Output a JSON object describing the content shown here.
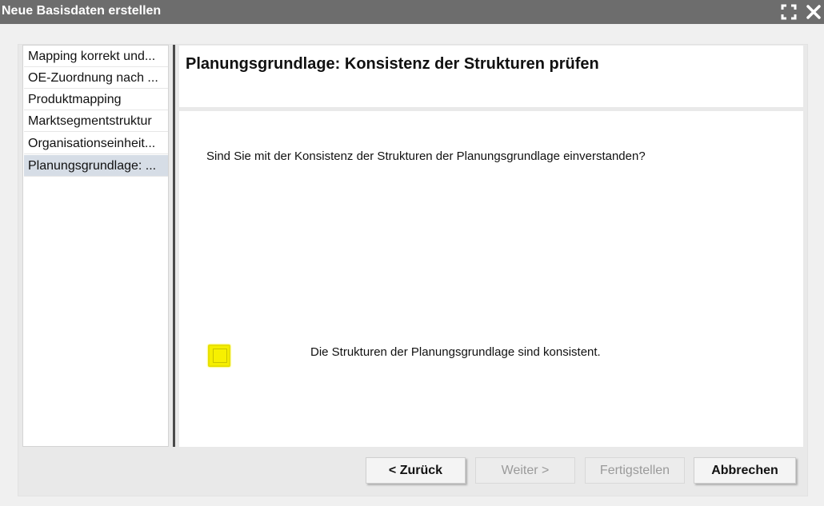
{
  "window": {
    "title": "Neue Basisdaten erstellen",
    "maximize_icon": "maximize-icon",
    "close_icon": "close-icon"
  },
  "sidebar": {
    "items": [
      {
        "label": "Mapping korrekt und..."
      },
      {
        "label": "OE-Zuordnung nach ..."
      },
      {
        "label": "Produktmapping"
      },
      {
        "label": "Marktsegmentstruktur"
      },
      {
        "label": "Organisationseinheit..."
      },
      {
        "label": "Planungsgrundlage: ..."
      }
    ],
    "selected_index": 5
  },
  "main": {
    "heading": "Planungsgrundlage: Konsistenz der Strukturen prüfen",
    "question": "Sind Sie mit der Konsistenz der Strukturen der Planungsgrundlage einverstanden?",
    "checkbox_label": "Die Strukturen der Planungsgrundlage sind konsistent.",
    "checkbox_checked": false,
    "checkbox_highlight_color": "#f5ee00"
  },
  "buttons": {
    "back": "< Zurück",
    "next": "Weiter >",
    "finish": "Fertigstellen",
    "cancel": "Abbrechen"
  }
}
